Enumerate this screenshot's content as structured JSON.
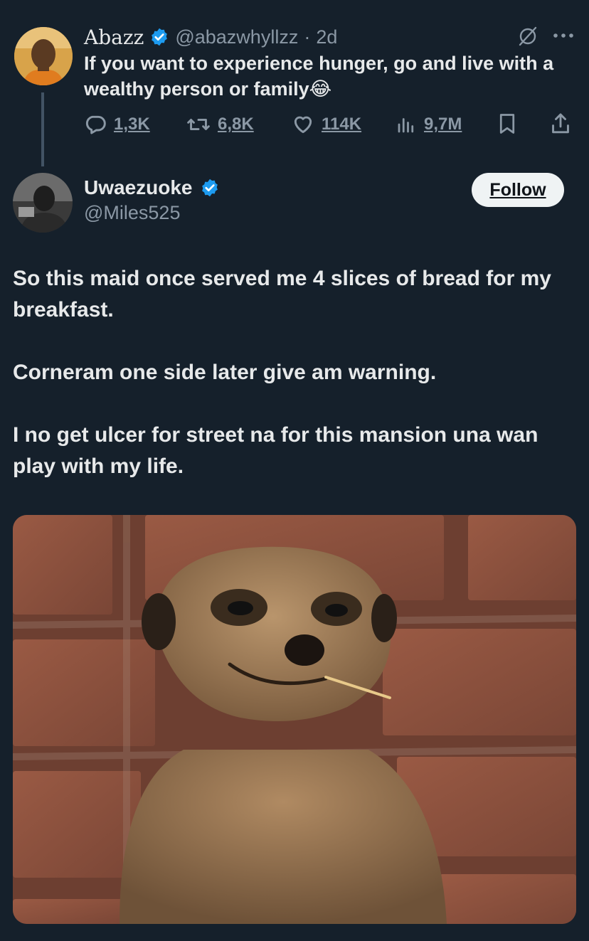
{
  "quoted": {
    "name": "Abazz",
    "handle": "@abazwhyllzz",
    "separator": "·",
    "time": "2d",
    "text": "If you want to experience hunger, go and live with a wealthy person or family",
    "emoji": "😂",
    "stats": {
      "replies": "1,3K",
      "reposts": "6,8K",
      "likes": "114K",
      "views": "9,7M"
    }
  },
  "reply": {
    "name": "Uwaezuoke",
    "handle": "@Miles525",
    "follow_label": "Follow",
    "paragraphs": [
      "So this maid once served me 4 slices of bread for my breakfast.",
      "Corneram one side later give am warning.",
      "I no get ulcer for street na for this mansion una wan play with my life."
    ]
  },
  "icons": {
    "verified": "verified-badge-icon",
    "grok": "grok-icon",
    "more": "more-icon",
    "reply": "reply-icon",
    "repost": "repost-icon",
    "like": "like-icon",
    "views": "views-icon",
    "bookmark": "bookmark-icon",
    "share": "share-icon"
  },
  "colors": {
    "background": "#15202b",
    "text": "#e7e9ea",
    "muted": "#8b98a5",
    "verified": "#1d9bf0",
    "follow_bg": "#eff3f4"
  }
}
